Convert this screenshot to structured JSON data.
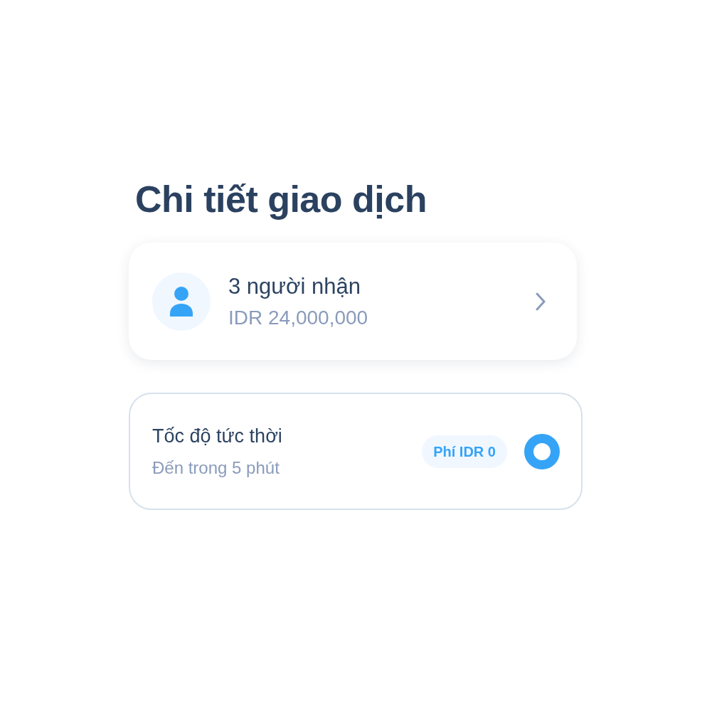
{
  "title": "Chi tiết giao dịch",
  "recipients_card": {
    "title": "3 người nhận",
    "amount": "IDR 24,000,000"
  },
  "speed_option": {
    "title": "Tốc độ tức thời",
    "subtitle": "Đến trong 5 phút",
    "fee_badge": "Phí IDR 0",
    "selected": true
  }
}
